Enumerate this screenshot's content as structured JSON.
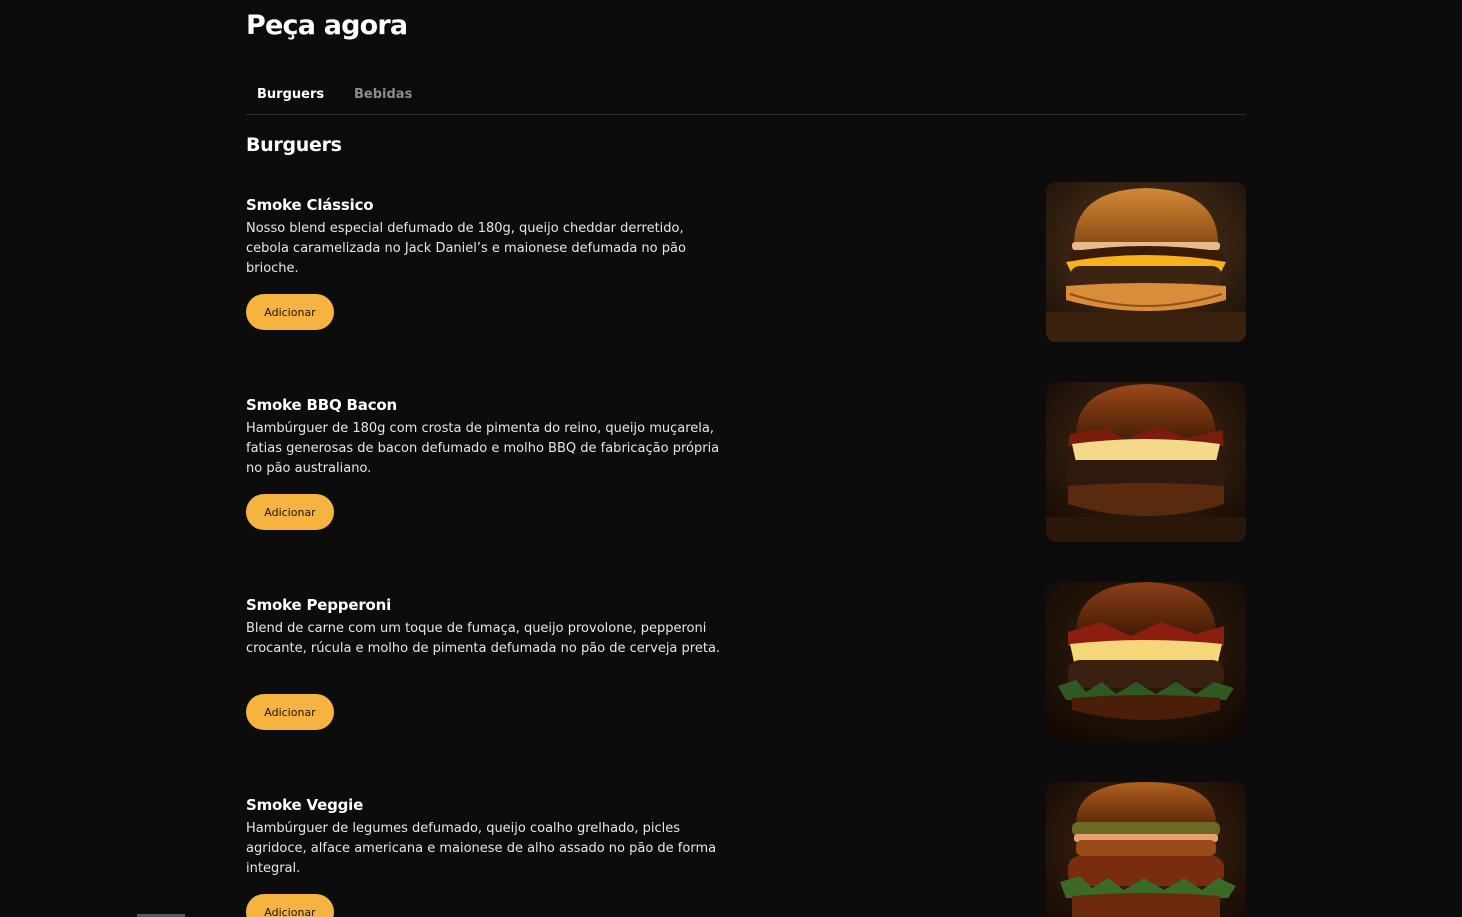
{
  "header": {
    "title": "Peça agora"
  },
  "tabs": [
    {
      "label": "Burguers",
      "active": true
    },
    {
      "label": "Bebidas",
      "active": false
    }
  ],
  "section": {
    "title": "Burguers"
  },
  "items": [
    {
      "name": "Smoke Clássico",
      "description": "Nosso blend especial defumado de 180g, queijo cheddar derretido, cebola caramelizada no Jack Daniel’s e maionese defumada no pão brioche.",
      "button_label": "Adicionar",
      "image_icon": "burger-classic-photo"
    },
    {
      "name": "Smoke BBQ Bacon",
      "description": "Hambúrguer de 180g com crosta de pimenta do reino, queijo muçarela, fatias generosas de bacon defumado e molho BBQ de fabricação própria no pão australiano.",
      "button_label": "Adicionar",
      "image_icon": "burger-bbq-bacon-photo"
    },
    {
      "name": "Smoke Pepperoni",
      "description": "Blend de carne com um toque de fumaça, queijo provolone, pepperoni crocante, rúcula e molho de pimenta defumada no pão de cerveja preta.",
      "button_label": "Adicionar",
      "image_icon": "burger-pepperoni-photo"
    },
    {
      "name": "Smoke Veggie",
      "description": "Hambúrguer de legumes defumado, queijo coalho grelhado, picles agridoce, alface americana e maionese de alho assado no pão de forma integral.",
      "button_label": "Adicionar",
      "image_icon": "burger-veggie-photo"
    }
  ],
  "colors": {
    "background": "#0c0c0d",
    "accent": "#f6b33f",
    "divider": "#2e2e30",
    "tab_inactive": "#8c8c8e"
  }
}
